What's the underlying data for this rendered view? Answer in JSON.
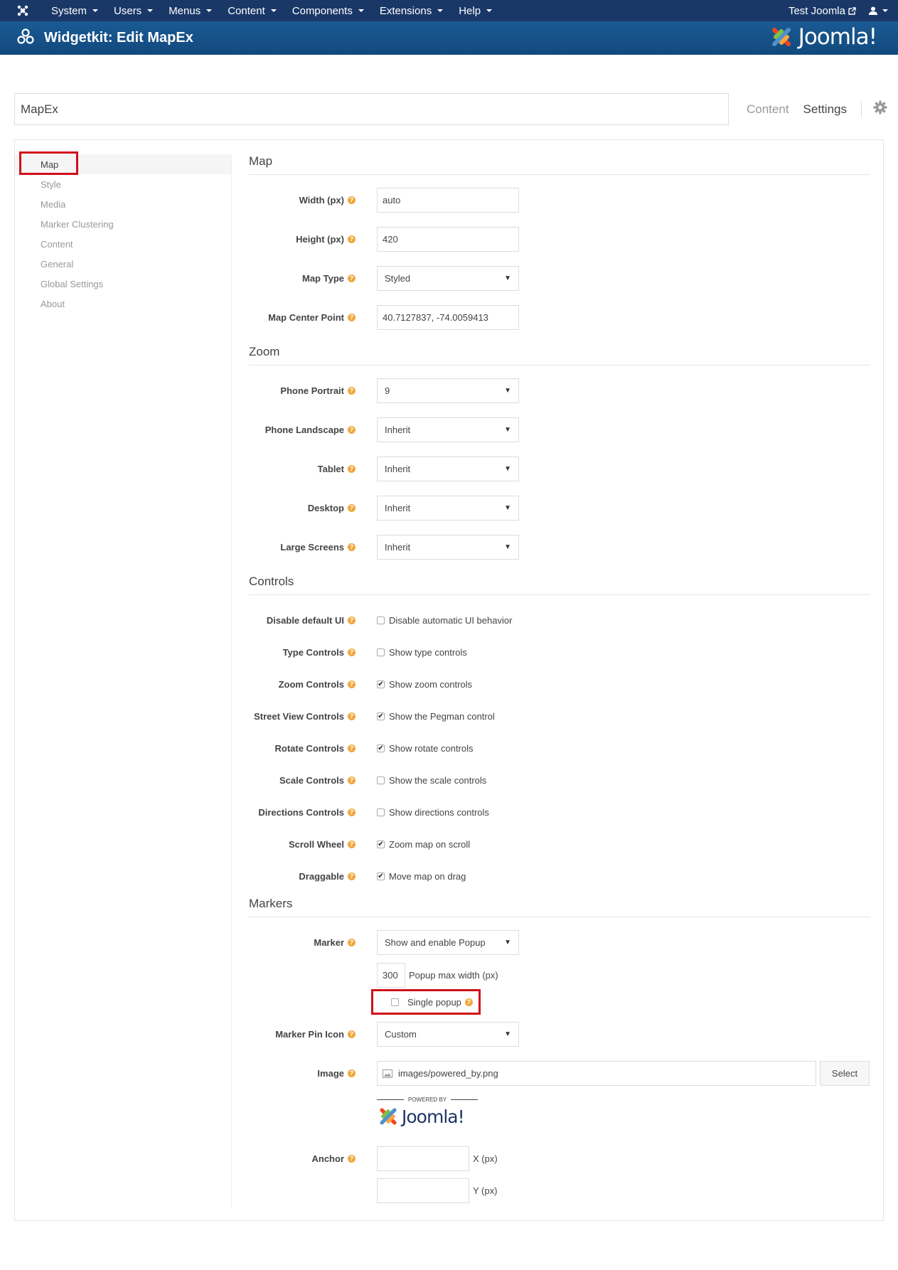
{
  "topnav": {
    "menu": [
      "System",
      "Users",
      "Menus",
      "Content",
      "Components",
      "Extensions",
      "Help"
    ],
    "user_site": "Test Joomla"
  },
  "header": {
    "title": "Widgetkit: Edit MapEx",
    "brand": "Joomla!"
  },
  "widget_name": "MapEx",
  "tabs": {
    "content": "Content",
    "settings": "Settings"
  },
  "sidebar": [
    "Map",
    "Style",
    "Media",
    "Marker Clustering",
    "Content",
    "General",
    "Global Settings",
    "About"
  ],
  "sections": {
    "map": "Map",
    "zoom": "Zoom",
    "controls": "Controls",
    "markers": "Markers"
  },
  "map": {
    "width_label": "Width (px)",
    "width_value": "auto",
    "height_label": "Height (px)",
    "height_value": "420",
    "type_label": "Map Type",
    "type_value": "Styled",
    "center_label": "Map Center Point",
    "center_value": "40.7127837, -74.0059413"
  },
  "zoom": [
    {
      "label": "Phone Portrait",
      "value": "9"
    },
    {
      "label": "Phone Landscape",
      "value": "Inherit"
    },
    {
      "label": "Tablet",
      "value": "Inherit"
    },
    {
      "label": "Desktop",
      "value": "Inherit"
    },
    {
      "label": "Large Screens",
      "value": "Inherit"
    }
  ],
  "controls": [
    {
      "label": "Disable default UI",
      "text": "Disable automatic UI behavior",
      "checked": false
    },
    {
      "label": "Type Controls",
      "text": "Show type controls",
      "checked": false
    },
    {
      "label": "Zoom Controls",
      "text": "Show zoom controls",
      "checked": true
    },
    {
      "label": "Street View Controls",
      "text": "Show the Pegman control",
      "checked": true
    },
    {
      "label": "Rotate Controls",
      "text": "Show rotate controls",
      "checked": true
    },
    {
      "label": "Scale Controls",
      "text": "Show the scale controls",
      "checked": false
    },
    {
      "label": "Directions Controls",
      "text": "Show directions controls",
      "checked": false
    },
    {
      "label": "Scroll Wheel",
      "text": "Zoom map on scroll",
      "checked": true
    },
    {
      "label": "Draggable",
      "text": "Move map on drag",
      "checked": true
    }
  ],
  "markers": {
    "marker_label": "Marker",
    "marker_value": "Show and enable Popup",
    "popup_width_value": "300",
    "popup_width_text": "Popup max width (px)",
    "single_popup_text": "Single popup",
    "pin_label": "Marker Pin Icon",
    "pin_value": "Custom",
    "image_label": "Image",
    "image_value": "images/powered_by.png",
    "select_btn": "Select",
    "powered_by": "POWERED BY",
    "powered_brand": "Joomla!",
    "anchor_label": "Anchor",
    "anchor_x": "X (px)",
    "anchor_y": "Y (px)"
  },
  "colors": {
    "topnav": "#1a3867",
    "header": "#17568c",
    "highlight": "#d0101a",
    "help": "#f0a83c"
  }
}
